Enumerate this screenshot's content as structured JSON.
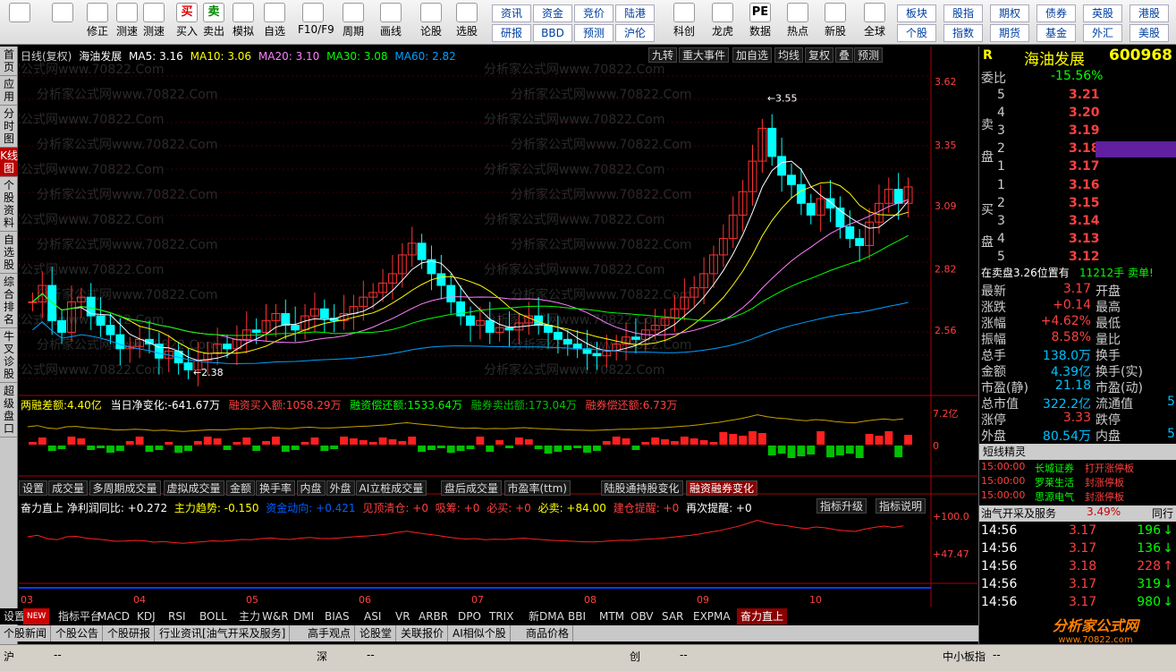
{
  "toolbar": {
    "left_buttons": [
      {
        "label": "",
        "icon": "windows-logo-icon"
      },
      {
        "label": "",
        "icon": "back-arrow-icon"
      },
      {
        "label": "修正",
        "icon": "arrows-icon"
      },
      {
        "label": "测速",
        "icon": "refresh-icon"
      },
      {
        "label": "测速",
        "icon": "clock-icon"
      },
      {
        "label": "买入",
        "icon": "buy-icon",
        "glyph": "买"
      },
      {
        "label": "卖出",
        "icon": "sell-icon",
        "glyph": "卖"
      },
      {
        "label": "模拟",
        "icon": "hammer-icon"
      },
      {
        "label": "自选",
        "icon": "star-icon"
      },
      {
        "label": "F10/F9",
        "icon": "f10-icon"
      },
      {
        "label": "周期",
        "icon": "cycle-icon"
      },
      {
        "label": "画线",
        "icon": "pen-icon"
      },
      {
        "label": "论股",
        "icon": "discuss-icon"
      },
      {
        "label": "选股",
        "icon": "select-stock-icon"
      }
    ],
    "grid1": [
      [
        "资讯",
        "资金",
        "竞价",
        "陆港"
      ],
      [
        "研报",
        "BBD",
        "预测",
        "沪伦"
      ]
    ],
    "mid_buttons": [
      {
        "label": "科创",
        "icon": "chart-icon"
      },
      {
        "label": "龙虎",
        "icon": "dragon-icon"
      },
      {
        "label": "数据",
        "icon": "pe-icon",
        "glyph": "PE"
      },
      {
        "label": "热点",
        "icon": "hot-icon"
      },
      {
        "label": "新股",
        "icon": "new-stock-icon"
      },
      {
        "label": "全球",
        "icon": "globe-icon"
      }
    ],
    "grid2": [
      [
        "板块",
        "股指",
        "期权",
        "债券",
        "英股",
        "港股"
      ],
      [
        "个股",
        "指数",
        "期货",
        "基金",
        "外汇",
        "美股"
      ]
    ]
  },
  "left_tabs": [
    "首页",
    "应用",
    "分时图",
    "K线图",
    "个股资料",
    "自选股",
    "综合排名",
    "牛叉诊股",
    "超级盘口"
  ],
  "chart": {
    "header": {
      "period": "日线(复权)",
      "name": "海油发展",
      "ma5": "MA5: 3.16",
      "ma10": "MA10: 3.06",
      "ma20": "MA20: 3.10",
      "ma30": "MA30: 3.08",
      "ma60": "MA60: 2.82"
    },
    "top_tabs": [
      "九转",
      "重大事件",
      "加自选",
      "均线",
      "复权",
      "叠",
      "预测"
    ],
    "price_labels": [
      "3.62",
      "3.35",
      "3.09",
      "2.82",
      "2.56"
    ],
    "high_mark": "3.55",
    "low_mark": "2.38",
    "watermark": "分析家公式网www.70822.Com",
    "margin_line": {
      "a": "两融差额:4.40亿",
      "b": "当日净变化:-641.67万",
      "c": "融资买入额:1058.29万",
      "d": "融资偿还额:1533.64万",
      "e": "融券卖出额:173.04万",
      "f": "融券偿还额:6.73万"
    },
    "margin_labels": [
      "7.2亿",
      "0"
    ],
    "subtabs": [
      "设置",
      "成交量",
      "多周期成交量",
      "虚拟成交量",
      "金额",
      "换手率",
      "内盘",
      "外盘",
      "AI立桩成交量",
      "盘后成交量",
      "市盈率(ttm)",
      "陆股通持股变化",
      "融资融券变化"
    ],
    "active_subtab": "融资融券变化",
    "indicator_line": {
      "a": "奋力直上 净利润同比: +0.272",
      "b": "主力趋势: -0.150",
      "c": "资金动向: +0.421",
      "d": "见顶清仓: +0",
      "e": "吸筹: +0",
      "f": "必买: +0",
      "g": "必卖: +84.00",
      "h": "建仓提醒: +0",
      "i": "再次提醒: +0"
    },
    "indicator_buttons": [
      "指标升级",
      "指标说明"
    ],
    "indicator_labels": [
      "+100.0",
      "+47.47"
    ],
    "months": [
      "03",
      "04",
      "05",
      "06",
      "07",
      "08",
      "09",
      "10"
    ]
  },
  "bottom_tabs": [
    "设置",
    "NEW",
    "指标平台",
    "MACD",
    "KDJ",
    "RSI",
    "BOLL",
    "主力",
    "W&R",
    "DMI",
    "BIAS",
    "ASI",
    "VR",
    "ARBR",
    "DPO",
    "TRIX",
    "新DMA",
    "BBI",
    "MTM",
    "OBV",
    "SAR",
    "EXPMA",
    "奋力直上"
  ],
  "info_tabs": [
    "个股新闻",
    "个股公告",
    "个股研报",
    "行业资讯[油气开采及服务]",
    "高手观点",
    "论股堂",
    "关联报价",
    "AI相似个股",
    "商品价格"
  ],
  "status": {
    "items": [
      "沪",
      "深",
      "创",
      "中小板指"
    ],
    "dash": "--"
  },
  "right": {
    "title_r": "R",
    "name": "海油发展",
    "code": "600968",
    "weibi_label": "委比",
    "weibi": "-15.56%",
    "sell_label": "卖盘",
    "buy_label": "买盘",
    "sells": [
      {
        "n": "5",
        "p": "3.21",
        "v": ""
      },
      {
        "n": "4",
        "p": "3.20",
        "v": ""
      },
      {
        "n": "3",
        "p": "3.19",
        "v": ""
      },
      {
        "n": "2",
        "p": "3.18",
        "v": ""
      },
      {
        "n": "1",
        "p": "3.17",
        "v": ""
      }
    ],
    "buys": [
      {
        "n": "1",
        "p": "3.16",
        "v": ""
      },
      {
        "n": "2",
        "p": "3.15",
        "v": ""
      },
      {
        "n": "3",
        "p": "3.14",
        "v": ""
      },
      {
        "n": "4",
        "p": "3.13",
        "v": ""
      },
      {
        "n": "5",
        "p": "3.12",
        "v": ""
      }
    ],
    "notice": "在卖盘3.26位置有",
    "notice2": "11212手 卖单!",
    "stats": [
      [
        "最新",
        "3.17",
        "开盘",
        ""
      ],
      [
        "涨跌",
        "+0.14",
        "最高",
        ""
      ],
      [
        "涨幅",
        "+4.62%",
        "最低",
        ""
      ],
      [
        "振幅",
        "8.58%",
        "量比",
        ""
      ],
      [
        "总手",
        "138.0万",
        "换手",
        ""
      ],
      [
        "金额",
        "4.39亿",
        "换手(实)",
        ""
      ],
      [
        "市盈(静)",
        "21.18",
        "市盈(动)",
        ""
      ],
      [
        "总市值",
        "322.2亿",
        "流通值",
        "5"
      ],
      [
        "涨停",
        "3.33",
        "跌停",
        ""
      ],
      [
        "外盘",
        "80.54万",
        "内盘",
        "5"
      ]
    ],
    "short_title": "短线精灵",
    "short_items": [
      [
        "15:00:00",
        "长城证券",
        "打开涨停板"
      ],
      [
        "15:00:00",
        "罗莱生活",
        "封涨停板"
      ],
      [
        "15:00:00",
        "思源电气",
        "封涨停板"
      ]
    ],
    "sector": "油气开采及服务",
    "sector_pct": "3.49%",
    "tongxing": "同行",
    "ticks": [
      [
        "14:56",
        "3.17",
        "196"
      ],
      [
        "14:56",
        "3.17",
        "136"
      ],
      [
        "14:56",
        "3.18",
        "228"
      ],
      [
        "14:56",
        "3.17",
        "319"
      ],
      [
        "14:56",
        "3.17",
        "980"
      ]
    ],
    "logo": "分析家公式网",
    "logo2": "www.70822.com"
  },
  "colors": {
    "up": "#ff3232",
    "down": "#00ffff",
    "ma5": "#ffffff",
    "ma10": "#ffff00",
    "ma20": "#ff80ff",
    "ma30": "#00ff00",
    "ma60": "#00a0ff"
  },
  "candles": [
    2.68,
    2.75,
    2.6,
    2.55,
    2.68,
    2.7,
    2.62,
    2.58,
    2.54,
    2.48,
    2.49,
    2.52,
    2.5,
    2.44,
    2.47,
    2.42,
    2.39,
    2.43,
    2.46,
    2.5,
    2.48,
    2.52,
    2.56,
    2.55,
    2.6,
    2.63,
    2.58,
    2.56,
    2.62,
    2.65,
    2.61,
    2.6,
    2.63,
    2.66,
    2.7,
    2.72,
    2.76,
    2.8,
    2.88,
    2.93,
    2.86,
    2.8,
    2.75,
    2.68,
    2.62,
    2.58,
    2.6,
    2.55,
    2.57,
    2.56,
    2.59,
    2.62,
    2.58,
    2.55,
    2.52,
    2.5,
    2.48,
    2.46,
    2.45,
    2.47,
    2.5,
    2.53,
    2.52,
    2.56,
    2.58,
    2.61,
    2.65,
    2.7,
    2.74,
    2.8,
    2.88,
    2.95,
    3.05,
    3.15,
    3.28,
    3.42,
    3.3,
    3.22,
    3.18,
    3.1,
    3.05,
    3.12,
    3.08,
    3.0,
    2.95,
    2.92,
    3.02,
    3.1,
    3.16,
    3.1,
    3.17
  ]
}
